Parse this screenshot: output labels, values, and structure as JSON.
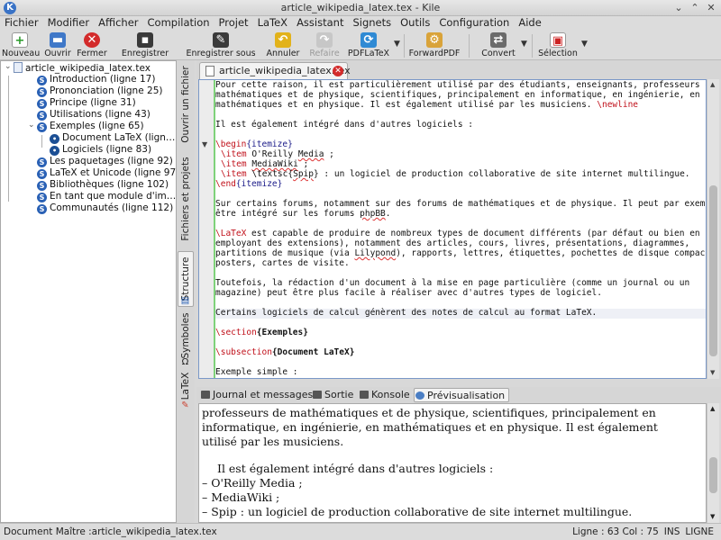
{
  "window": {
    "title": "article_wikipedia_latex.tex - Kile",
    "app_icon": "K",
    "min": "⌄",
    "max": "⌃",
    "close": "✕"
  },
  "menu": [
    "Fichier",
    "Modifier",
    "Afficher",
    "Compilation",
    "Projet",
    "LaTeX",
    "Assistant",
    "Signets",
    "Outils",
    "Configuration",
    "Aide"
  ],
  "toolbar": {
    "nouveau": "Nouveau",
    "ouvrir": "Ouvrir",
    "fermer": "Fermer",
    "enregistrer": "Enregistrer",
    "enregistrer_sous": "Enregistrer sous",
    "annuler": "Annuler",
    "refaire": "Refaire",
    "pdflatex": "PDFLaTeX",
    "forwardpdf": "ForwardPDF",
    "convert": "Convert",
    "selection": "Sélection"
  },
  "structure": {
    "root": "article_wikipedia_latex.tex",
    "items": [
      "Introduction (ligne 17)",
      "Prononciation (ligne 25)",
      "Principe (ligne 31)",
      "Utilisations (ligne 43)",
      "Exemples (ligne 65)",
      "Document LaTeX (lign…",
      "Logiciels (ligne 83)",
      "Les paquetages (ligne 92)",
      "LaTeX et Unicode (ligne 97)",
      "Bibliothèques (ligne 102)",
      "En tant que module d'im…",
      "Communautés (ligne 112)"
    ]
  },
  "side_tabs": {
    "ouvrir_fichier": "Ouvrir un fichier",
    "fichiers_projets": "Fichiers et projets",
    "structure": "Structure",
    "symboles": "Symboles",
    "latex": "LaTeX"
  },
  "editor": {
    "tab_label": "article_wikipedia_latex.tex",
    "lines": {
      "l1": "Pour cette raison, il est particulièrement utilisé par des étudiants, enseignants, professeurs de",
      "l2": "mathématiques et de physique, scientifiques, principalement en informatique, en ingénierie, en",
      "l3": "mathématiques et en physique. Il est également utilisé par les musiciens. ",
      "l3cmd": "\\newline",
      "l5": "Il est également intégré dans d'autres logiciels :",
      "l7cmd": "\\begin",
      "l7arg": "{itemize}",
      "l8a": "\\item",
      "l8b": " O'Reilly ",
      "l8c": "Media",
      "l8d": " ;",
      "l9a": "\\item",
      "l9b": " ",
      "l9c": "MediaWiki",
      "l9d": " ;",
      "l10a": "\\item",
      "l10b": " \\textsc{",
      "l10c": "Spip",
      "l10d": "} : un logiciel de production collaborative de site internet multilingue.",
      "l11cmd": "\\end",
      "l11arg": "{itemize}",
      "l13": "Sur certains forums, notamment sur des forums de mathématiques et de physique. Il peut par exemple",
      "l14a": "être intégré sur les forums ",
      "l14b": "phpBB",
      "l14c": ".",
      "l16a": "\\LaTeX",
      "l16b": " est capable de produire de nombreux types de document différents (par défaut ou bien en",
      "l17": "employant des extensions), notamment des articles, cours, livres, présentations, diagrammes,",
      "l18a": "partitions de musique (via ",
      "l18b": "Lilypond",
      "l18c": "), rapports, lettres, étiquettes, pochettes de disque compact,",
      "l19": "posters, cartes de visite.",
      "l21": "Toutefois, la rédaction d'un document à la mise en page particulière (comme un journal ou un",
      "l22": "magazine) peut être plus facile à réaliser avec d'autres types de logiciel.",
      "l24": "Certains logiciels de calcul génèrent des notes de calcul au format LaTeX.",
      "l26cmd": "\\section",
      "l26arg": "{Exemples}",
      "l28cmd": "\\subsection",
      "l28arg": "{Document LaTeX}",
      "l30": "Exemple simple :"
    }
  },
  "bottom_tabs": [
    "Journal et messages",
    "Sortie",
    "Konsole",
    "Prévisualisation"
  ],
  "preview": {
    "p1": "professeurs de mathématiques et de physique, scientifiques, principalement en",
    "p2": "informatique, en ingénierie, en mathématiques et en physique. Il est également",
    "p3": "utilisé par les musiciens.",
    "p4": "Il est également intégré dans d'autres logiciels :",
    "p5": "–  O'Reilly Media ;",
    "p6": "–  MediaWiki ;",
    "p7": "–  Spip : un logiciel de production collaborative de site internet multilingue.",
    "p8": "–  ..."
  },
  "status": {
    "master": "Document Maître :article_wikipedia_latex.tex",
    "position": "Ligne : 63 Col : 75",
    "mode1": "INS",
    "mode2": "LIGNE"
  },
  "colors": {
    "accent": "#2a61b5",
    "latex_cmd": "#c0101a",
    "fold_bar": "#7fd27a"
  }
}
